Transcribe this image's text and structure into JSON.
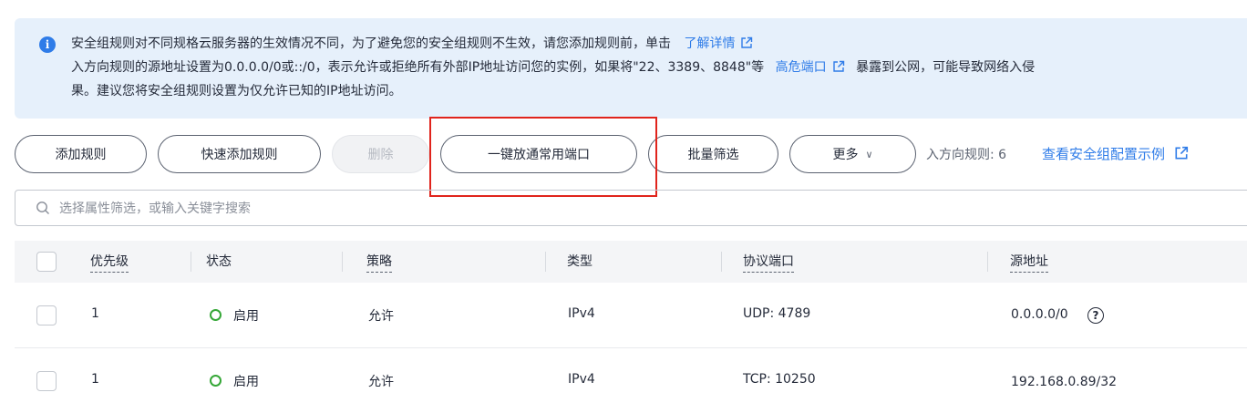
{
  "banner": {
    "line1_text": "安全组规则对不同规格云服务器的生效情况不同，为了避免您的安全组规则不生效，请您添加规则前，单击",
    "line1_link": "了解详情",
    "line2_text": "入方向规则的源地址设置为0.0.0.0/0或::/0，表示允许或拒绝所有外部IP地址访问您的实例，如果将\"22、3389、8848\"等",
    "line2_link": "高危端口",
    "line2_after": "暴露到公网，可能导致网络入侵",
    "line3_text": "果。建议您将安全组规则设置为仅允许已知的IP地址访问。"
  },
  "toolbar": {
    "add_rule": "添加规则",
    "quick_add_rule": "快速添加规则",
    "delete": "删除",
    "open_common_ports": "一键放通常用端口",
    "batch_filter": "批量筛选",
    "more": "更多",
    "inbound_rules_count": "入方向规则: 6",
    "view_example": "查看安全组配置示例"
  },
  "search": {
    "placeholder": "选择属性筛选，或输入关键字搜索"
  },
  "table": {
    "headers": {
      "priority": "优先级",
      "status": "状态",
      "policy": "策略",
      "type": "类型",
      "protocol_port": "协议端口",
      "source": "源地址"
    },
    "rows": [
      {
        "priority": "1",
        "status": "启用",
        "policy": "允许",
        "type": "IPv4",
        "protocol_port": "UDP: 4789",
        "source": "0.0.0.0/0"
      },
      {
        "priority": "1",
        "status": "启用",
        "policy": "允许",
        "type": "IPv4",
        "protocol_port": "TCP: 10250",
        "source": "192.168.0.89/32"
      }
    ]
  },
  "colors": {
    "link": "#2f7ce8",
    "banner_bg": "#e6f0fb",
    "highlight": "#e0241c",
    "status_enabled": "#35a737"
  }
}
